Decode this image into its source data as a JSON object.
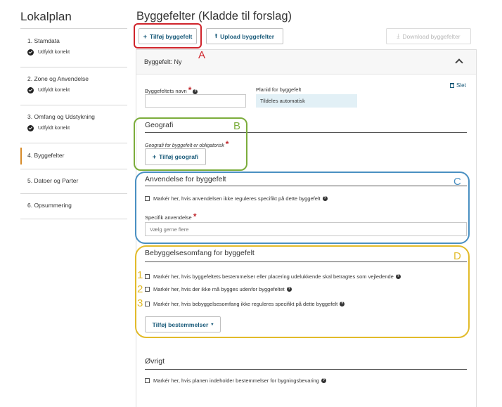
{
  "sidebar": {
    "title": "Lokalplan",
    "items": [
      {
        "label": "1. Stamdata",
        "status": "Udfyldt korrekt"
      },
      {
        "label": "2. Zone og Anvendelse",
        "status": "Udfyldt korrekt"
      },
      {
        "label": "3. Omfang og Udstykning",
        "status": "Udfyldt korrekt"
      },
      {
        "label": "4. Byggefelter",
        "status": ""
      },
      {
        "label": "5. Datoer og Parter",
        "status": ""
      },
      {
        "label": "6. Opsummering",
        "status": ""
      }
    ]
  },
  "main": {
    "title": "Byggefelter (Kladde til forslag)",
    "toolbar": {
      "add_label": "Tilføj byggefelt",
      "upload_label": "Upload byggefelter",
      "download_label": "Download byggefelter"
    },
    "panel": {
      "header_label": "Byggefelt: Ny",
      "delete_label": "Slet",
      "name_label": "Byggefeltets navn",
      "name_value": "",
      "planid_label": "Planid for byggefelt",
      "planid_value": "Tildeles automatisk",
      "geografi": {
        "title": "Geografi",
        "hint": "Geografi for byggefelt er obligatorisk",
        "button_label": "Tilføj geografi"
      },
      "anvendelse": {
        "title": "Anvendelse for byggefelt",
        "checkbox_label": "Markér her, hvis anvendelsen ikke reguleres specifikt på dette byggefelt",
        "specific_label": "Specifik anvendelse",
        "placeholder": "Vælg gerne flere"
      },
      "bebyggelse": {
        "title": "Bebyggelsesomfang for byggefelt",
        "checkboxes": [
          "Markér her, hvis byggefeltets bestemmelser eller placering udelukkende skal betragtes som vejledende",
          "Markér her, hvis der ikke må bygges udenfor byggefeltet",
          "Markér her, hvis bebyggelsesomfang ikke reguleres specifikt på dette byggefelt"
        ],
        "button_label": "Tilføj bestemmelser"
      },
      "ovrigt": {
        "title": "Øvrigt",
        "checkbox_label": "Markér her, hvis planen indeholder bestemmelser for bygningsbevaring"
      }
    }
  },
  "annotations": {
    "letters": [
      "A",
      "B",
      "C",
      "D"
    ],
    "numbers": [
      "1",
      "2",
      "3"
    ],
    "colors": {
      "A": "#d0242b",
      "B": "#7cad3c",
      "C": "#4a90c2",
      "D": "#e2bb2a"
    }
  },
  "icons": {
    "add": "plus-icon",
    "upload": "upload-icon",
    "download": "download-icon",
    "delete": "trash-icon",
    "collapse": "chevron-up-icon",
    "help": "question-circle-icon",
    "status": "check-circle-icon",
    "dropdown": "caret-down-icon"
  }
}
